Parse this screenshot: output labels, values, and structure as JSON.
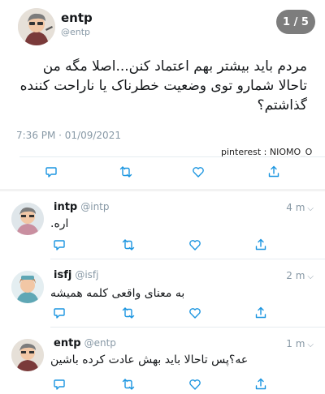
{
  "main_tweet": {
    "name": "entp",
    "handle": "@entp",
    "pager": "1 / 5",
    "text": "مردم باید بیشتر بهم اعتماد کنن...اصلا مگه من تاحالا شمارو توی وضعیت خطرناک یا ناراحت کننده گذاشتم؟",
    "meta": "7:36 PM · 01/09/2021",
    "watermark": "pinterest : NIOMO_O"
  },
  "replies": [
    {
      "name": "intp",
      "handle": "@intp",
      "time": "4 m",
      "text": "اره."
    },
    {
      "name": "isfj",
      "handle": "@isfj",
      "time": "2 m",
      "text": "به معنای واقعی کلمه همیشه"
    },
    {
      "name": "entp",
      "handle": "@entp",
      "time": "1 m",
      "text": "عه؟پس تاحالا باید بهش عادت کرده باشین"
    }
  ],
  "colors": {
    "icon": "#1b95e0",
    "muted": "#8899a6",
    "pager_bg": "#7d7d7d"
  },
  "icons": [
    "reply-icon",
    "retweet-icon",
    "like-icon",
    "share-icon",
    "chevron-down-icon"
  ]
}
